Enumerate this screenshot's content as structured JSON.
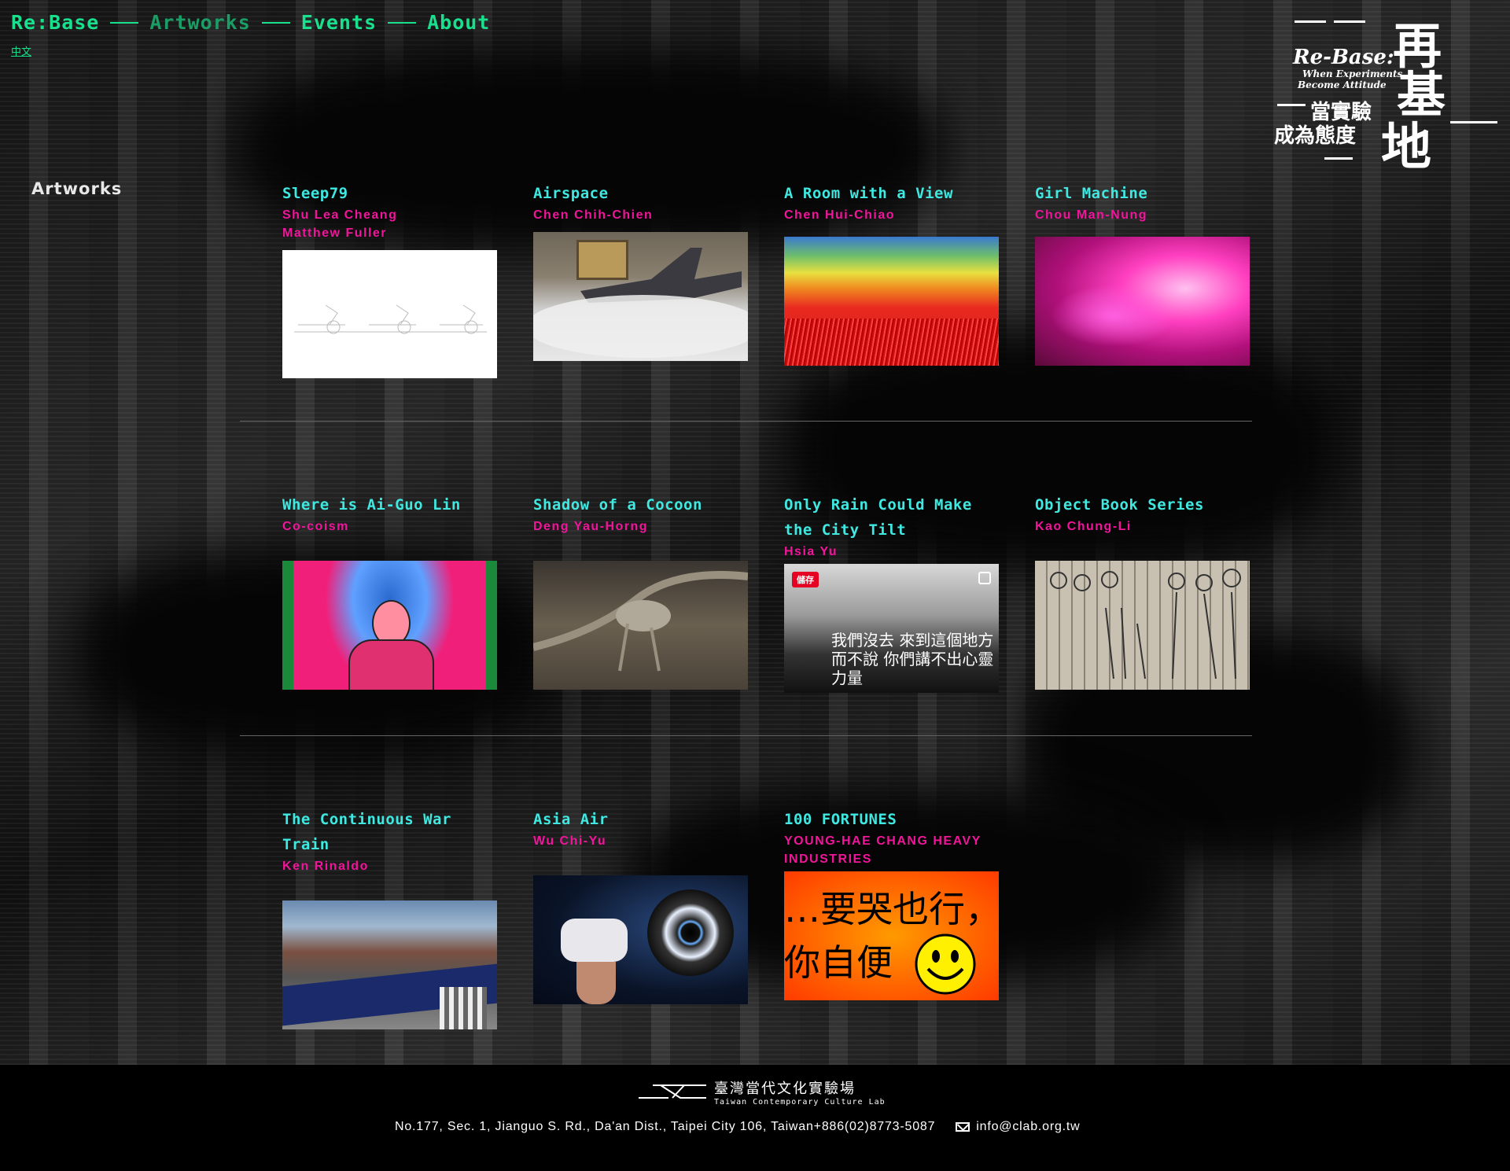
{
  "nav": {
    "items": [
      {
        "label": "Re:Base"
      },
      {
        "label": "Artworks"
      },
      {
        "label": "Events"
      },
      {
        "label": "About"
      }
    ],
    "lang": "中文"
  },
  "logo": {
    "title_en": "Re-Base:",
    "sub_en_1": "When Experiments",
    "sub_en_2": "Become Attitude",
    "cn_line_1": "當實驗",
    "cn_line_2": "成為態度",
    "big_1": "再",
    "big_2": "基",
    "big_3": "地"
  },
  "section_title": "Artworks",
  "artworks": [
    {
      "title": "Sleep79",
      "artist": "Shu Lea Cheang",
      "artist2": "Matthew Fuller",
      "thumb": "sleep79-sketch"
    },
    {
      "title": "Airspace",
      "artist": "Chen Chih-Chien",
      "thumb": "airspace-plane"
    },
    {
      "title": "A Room with a View",
      "artist": "Chen Hui-Chiao",
      "thumb": "rainbow-threads"
    },
    {
      "title": "Girl Machine",
      "artist": "Chou Man-Nung",
      "thumb": "pink-hair"
    },
    {
      "title": "Where is Ai-Guo Lin",
      "artist": "Co-coism",
      "thumb": "goddess-poster"
    },
    {
      "title": "Shadow of a Cocoon",
      "artist": "Deng Yau-Horng",
      "thumb": "cocoon-installation"
    },
    {
      "title": "Only Rain Could Make the City Tilt",
      "artist": "Hsia Yu",
      "thumb": "subway-writing",
      "thumb_text": "我們沒去 來到這個地方而不說 你們講不出心靈力量",
      "save_label": "儲存"
    },
    {
      "title": "Object Book Series",
      "artist": "Kao Chung-Li",
      "thumb": "figure-drawing"
    },
    {
      "title": "The Continuous War Train",
      "artist": "Ken Rinaldo",
      "thumb": "war-train"
    },
    {
      "title": "Asia Air",
      "artist": "Wu Chi-Yu",
      "thumb": "vr-headset"
    },
    {
      "title": "100 FORTUNES",
      "artist": "YOUNG-HAE CHANG HEAVY INDUSTRIES",
      "thumb": "fortunes-text",
      "thumb_line1": "…要哭也行，",
      "thumb_line2": "你自便"
    }
  ],
  "footer": {
    "logo_cn": "臺灣當代文化實驗場",
    "logo_en": "Taiwan Contemporary Culture Lab",
    "address": "No.177, Sec. 1, Jianguo S. Rd., Da'an Dist., Taipei City 106, Taiwan+886(02)8773-5087",
    "email": "info@clab.org.tw"
  },
  "colors": {
    "nav": "#19e08c",
    "title": "#3fe8e0",
    "artist": "#f0159a",
    "footer_bg": "#000000"
  }
}
